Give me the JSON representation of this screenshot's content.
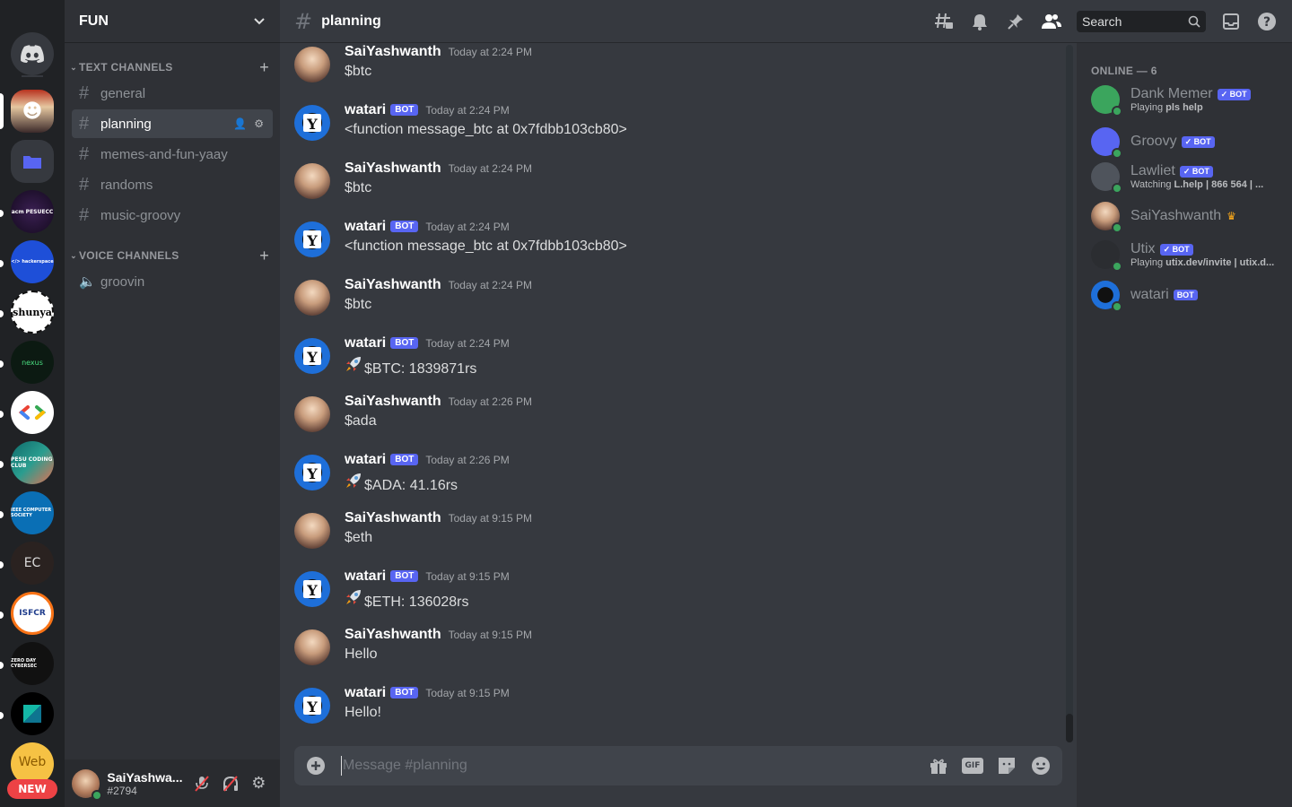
{
  "guild": {
    "name": "FUN"
  },
  "servers": [
    {
      "name": "discord-home",
      "label": ""
    },
    {
      "name": "fun",
      "label": ""
    },
    {
      "name": "folder",
      "label": ""
    },
    {
      "name": "acm-pesuecc",
      "label": "acm PESUECC"
    },
    {
      "name": "hackerspace",
      "label": "</> hackerspace"
    },
    {
      "name": "shunya",
      "label": "shunya"
    },
    {
      "name": "nexus",
      "label": "nexus"
    },
    {
      "name": "gdsc",
      "label": ""
    },
    {
      "name": "pesu-coding-club",
      "label": "PESU CODING CLUB"
    },
    {
      "name": "ieee-computer-society",
      "label": "IEEE COMPUTER SOCIETY"
    },
    {
      "name": "ec",
      "label": "EC"
    },
    {
      "name": "isfcr",
      "label": "ISFCR"
    },
    {
      "name": "zero-day-cybersec",
      "label": "ZERO DAY CYBERSEC"
    },
    {
      "name": "kite",
      "label": ""
    },
    {
      "name": "web",
      "label": "Web"
    }
  ],
  "rail": {
    "new_badge": "NEW"
  },
  "categories": {
    "text": "TEXT CHANNELS",
    "voice": "VOICE CHANNELS"
  },
  "channels": {
    "text": [
      "general",
      "planning",
      "memes-and-fun-yaay",
      "randoms",
      "music-groovy"
    ],
    "voice": [
      "groovin"
    ]
  },
  "user": {
    "name": "SaiYashwa...",
    "tag": "#2794"
  },
  "topbar": {
    "channel": "planning",
    "search_placeholder": "Search"
  },
  "messages": [
    {
      "author": "SaiYashwanth",
      "bot": false,
      "time": "Today at 2:24 PM",
      "text": "$btc"
    },
    {
      "author": "watari",
      "bot": true,
      "time": "Today at 2:24 PM",
      "text": "<function message_btc at 0x7fdbb103cb80>"
    },
    {
      "author": "SaiYashwanth",
      "bot": false,
      "time": "Today at 2:24 PM",
      "text": "$btc"
    },
    {
      "author": "watari",
      "bot": true,
      "time": "Today at 2:24 PM",
      "text": "<function message_btc at 0x7fdbb103cb80>"
    },
    {
      "author": "SaiYashwanth",
      "bot": false,
      "time": "Today at 2:24 PM",
      "text": "$btc"
    },
    {
      "author": "watari",
      "bot": true,
      "time": "Today at 2:24 PM",
      "text": "$BTC: 1839871rs",
      "rocket": true
    },
    {
      "author": "SaiYashwanth",
      "bot": false,
      "time": "Today at 2:26 PM",
      "text": "$ada"
    },
    {
      "author": "watari",
      "bot": true,
      "time": "Today at 2:26 PM",
      "text": "$ADA: 41.16rs",
      "rocket": true
    },
    {
      "author": "SaiYashwanth",
      "bot": false,
      "time": "Today at 9:15 PM",
      "text": "$eth"
    },
    {
      "author": "watari",
      "bot": true,
      "time": "Today at 9:15 PM",
      "text": "$ETH: 136028rs",
      "rocket": true
    },
    {
      "author": "SaiYashwanth",
      "bot": false,
      "time": "Today at 9:15 PM",
      "text": "Hello"
    },
    {
      "author": "watari",
      "bot": true,
      "time": "Today at 9:15 PM",
      "text": "Hello!"
    }
  ],
  "bot_label": "BOT",
  "composer": {
    "placeholder": "Message #planning",
    "gif": "GIF"
  },
  "members": {
    "header": "ONLINE — 6",
    "list": [
      {
        "name": "Dank Memer",
        "badge": "✓ BOT",
        "activity_prefix": "Playing ",
        "activity": "pls help",
        "color": "#3ba55d"
      },
      {
        "name": "Groovy",
        "badge": "✓ BOT",
        "activity_prefix": "",
        "activity": "",
        "color": "#5865f2"
      },
      {
        "name": "Lawliet",
        "badge": "✓ BOT",
        "activity_prefix": "Watching ",
        "activity": "L.help | 866 564 | ...",
        "color": "#4f545c"
      },
      {
        "name": "SaiYashwanth",
        "badge": "",
        "activity_prefix": "",
        "activity": "",
        "color": "#8a6d5a",
        "crown": true
      },
      {
        "name": "Utix",
        "badge": "✓ BOT",
        "activity_prefix": "Playing ",
        "activity": "utix.dev/invite | utix.d...",
        "color": "#2b2d31"
      },
      {
        "name": "watari",
        "badge": "BOT",
        "activity_prefix": "",
        "activity": "",
        "color": "#1e6fd9"
      }
    ]
  }
}
